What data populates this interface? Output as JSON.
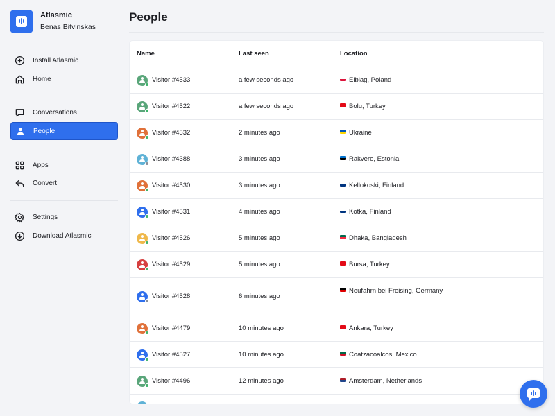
{
  "brand": {
    "name": "Atlasmic",
    "user": "Benas Bitvinskas",
    "accent": "#2f6fed"
  },
  "sidebar": {
    "groups": [
      [
        {
          "label": "Install Atlasmic",
          "icon": "plus-circle-icon"
        },
        {
          "label": "Home",
          "icon": "home-icon"
        }
      ],
      [
        {
          "label": "Conversations",
          "icon": "chat-icon"
        },
        {
          "label": "People",
          "icon": "person-icon",
          "active": true
        }
      ],
      [
        {
          "label": "Apps",
          "icon": "grid-icon"
        },
        {
          "label": "Convert",
          "icon": "reply-icon"
        }
      ],
      [
        {
          "label": "Settings",
          "icon": "gear-icon"
        },
        {
          "label": "Download Atlasmic",
          "icon": "download-circle-icon"
        }
      ]
    ]
  },
  "page": {
    "title": "People"
  },
  "table": {
    "headers": {
      "name": "Name",
      "last_seen": "Last seen",
      "location": "Location"
    },
    "rows": [
      {
        "name": "Visitor #4533",
        "last_seen": "a few seconds ago",
        "location": "Elblag, Poland",
        "avatar_color": "#5aa67a",
        "status_color": "#3fb36b",
        "flag": [
          "#ffffff",
          "#dc143c"
        ]
      },
      {
        "name": "Visitor #4522",
        "last_seen": "a few seconds ago",
        "location": "Bolu, Turkey",
        "avatar_color": "#5aa67a",
        "status_color": "#3fb36b",
        "flag": [
          "#e30a17",
          "#e30a17"
        ]
      },
      {
        "name": "Visitor #4532",
        "last_seen": "2 minutes ago",
        "location": "Ukraine",
        "avatar_color": "#e0713a",
        "status_color": "#3fb36b",
        "flag": [
          "#0057b7",
          "#ffd700"
        ]
      },
      {
        "name": "Visitor #4388",
        "last_seen": "3 minutes ago",
        "location": "Rakvere, Estonia",
        "avatar_color": "#5fb2d6",
        "status_color": "#8a8f99",
        "flag": [
          "#0072ce",
          "#000000"
        ]
      },
      {
        "name": "Visitor #4530",
        "last_seen": "3 minutes ago",
        "location": "Kellokoski, Finland",
        "avatar_color": "#e0713a",
        "status_color": "#3fb36b",
        "flag": [
          "#ffffff",
          "#003580"
        ]
      },
      {
        "name": "Visitor #4531",
        "last_seen": "4 minutes ago",
        "location": "Kotka, Finland",
        "avatar_color": "#2f6fed",
        "status_color": "#3fb36b",
        "flag": [
          "#ffffff",
          "#003580"
        ]
      },
      {
        "name": "Visitor #4526",
        "last_seen": "5 minutes ago",
        "location": "Dhaka, Bangladesh",
        "avatar_color": "#efb84a",
        "status_color": "#3fb36b",
        "flag": [
          "#006a4e",
          "#f42a41"
        ]
      },
      {
        "name": "Visitor #4529",
        "last_seen": "5 minutes ago",
        "location": "Bursa, Turkey",
        "avatar_color": "#d64040",
        "status_color": "#3fb36b",
        "flag": [
          "#e30a17",
          "#e30a17"
        ]
      },
      {
        "name": "Visitor #4528",
        "last_seen": "6 minutes ago",
        "location": "Neufahrn bei Freising, Germany",
        "avatar_color": "#2f6fed",
        "status_color": "#8a8f99",
        "flag": [
          "#000000",
          "#dd0000"
        ]
      },
      {
        "name": "Visitor #4479",
        "last_seen": "10 minutes ago",
        "location": "Ankara, Turkey",
        "avatar_color": "#e0713a",
        "status_color": "#3fb36b",
        "flag": [
          "#e30a17",
          "#e30a17"
        ]
      },
      {
        "name": "Visitor #4527",
        "last_seen": "10 minutes ago",
        "location": "Coatzacoalcos, Mexico",
        "avatar_color": "#2f6fed",
        "status_color": "#3fb36b",
        "flag": [
          "#006847",
          "#ce1126"
        ]
      },
      {
        "name": "Visitor #4496",
        "last_seen": "12 minutes ago",
        "location": "Amsterdam, Netherlands",
        "avatar_color": "#5aa67a",
        "status_color": "#3fb36b",
        "flag": [
          "#ae1c28",
          "#21468b"
        ]
      }
    ]
  },
  "chat_button": {
    "icon": "chat-bubble-icon"
  }
}
